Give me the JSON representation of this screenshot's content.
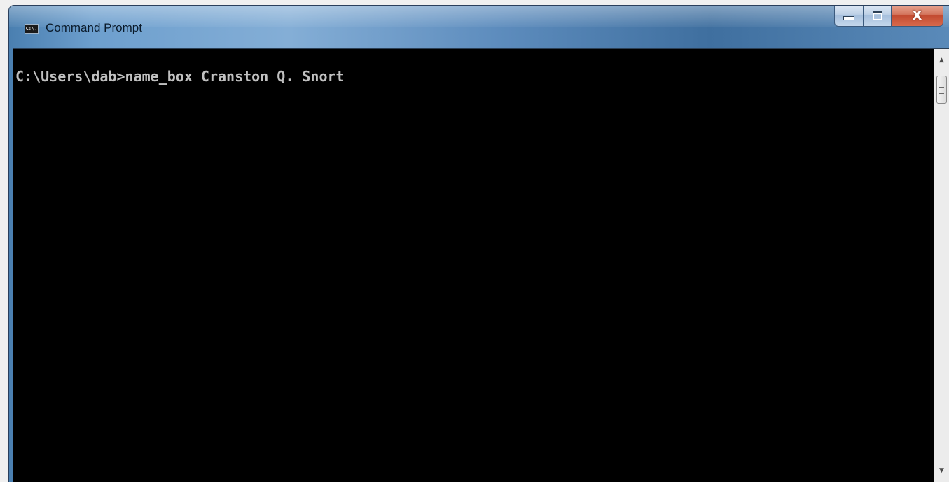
{
  "window": {
    "title": "Command Prompt",
    "icon": "cmd-icon",
    "icon_text": "C:\\.",
    "buttons": {
      "minimize_icon": "minimize-icon",
      "maximize_icon": "maximize-icon",
      "close_icon": "close-icon",
      "close_glyph": "X"
    }
  },
  "console": {
    "lines": [
      "C:\\Users\\dab>name_box Cranston Q. Snort"
    ]
  },
  "scrollbar": {
    "up_arrow": "▲",
    "down_arrow": "▼"
  },
  "colors": {
    "console_bg": "#000000",
    "console_fg": "#c0c0c0",
    "close_button": "#c24a30"
  }
}
